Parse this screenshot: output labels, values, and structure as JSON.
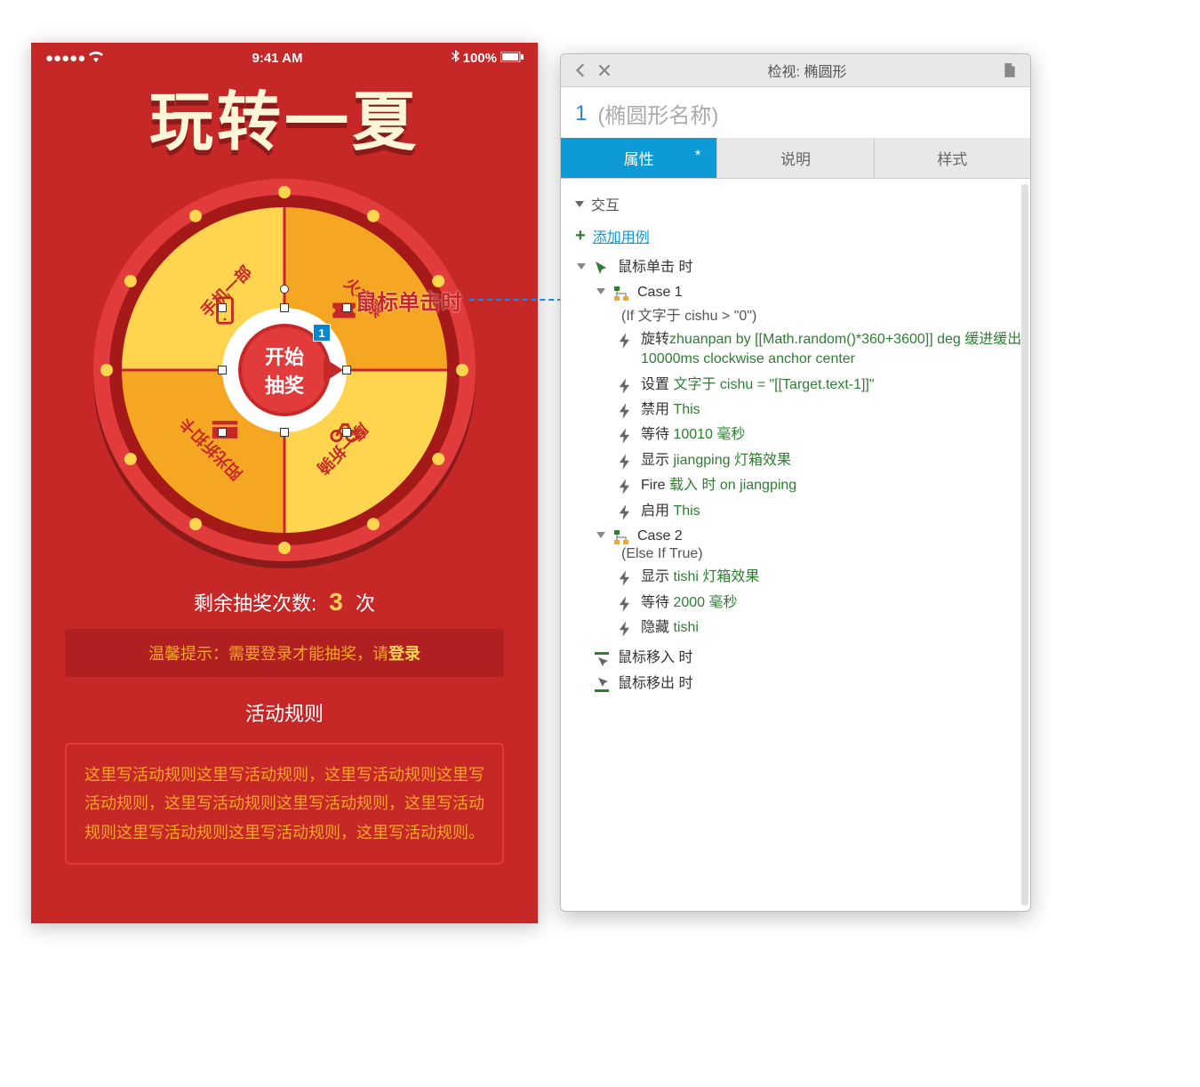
{
  "phone": {
    "status": {
      "time": "9:41 AM",
      "battery": "100%"
    },
    "title": "玩转一夏",
    "wheel": {
      "center_line1": "开始",
      "center_line2": "抽奖",
      "fn_badge": "1",
      "sectors": [
        "手机一部",
        "火车票",
        "阳光折扣卡",
        "摩一折骑"
      ]
    },
    "remaining": {
      "prefix": "剩余抽奖次数:",
      "count": "3",
      "suffix": "次"
    },
    "tip": {
      "text": "温馨提示：需要登录才能抽奖，请",
      "login": "登录"
    },
    "rules_title": "活动规则",
    "rules_body": "这里写活动规则这里写活动规则，这里写活动规则这里写活动规则，这里写活动规则这里写活动规则，这里写活动规则这里写活动规则这里写活动规则，这里写活动规则。"
  },
  "callout": "鼠标单击时",
  "panel": {
    "title": "检视: 椭圆形",
    "widget_index": "1",
    "widget_name": "(椭圆形名称)",
    "tabs": {
      "props": "属性",
      "notes": "说明",
      "style": "样式",
      "star": "*"
    },
    "section": "交互",
    "add_case": "添加用例",
    "events": {
      "click": "鼠标单击 时",
      "mouseenter": "鼠标移入 时",
      "mouseleave": "鼠标移出 时"
    },
    "case1": {
      "name": "Case 1",
      "condition": "(If 文字于 cishu > \"0\")",
      "a1_pre": "旋转",
      "a1_mid": "zhuanpan by [[Math.random()*360+3600]] deg 缓进缓出 10000ms clockwise anchor center",
      "a2_pre": "设置 ",
      "a2_mid": "文字于 cishu = \"[[Target.text-1]]\"",
      "a3_pre": "禁用 ",
      "a3_mid": "This",
      "a4_pre": "等待 ",
      "a4_mid": "10010 毫秒",
      "a5_pre": "显示 ",
      "a5_mid": "jiangping 灯箱效果",
      "a6_pre": "Fire ",
      "a6_mid": "载入 时 on jiangping",
      "a7_pre": "启用 ",
      "a7_mid": "This"
    },
    "case2": {
      "name": "Case 2",
      "condition": "(Else If True)",
      "a1_pre": "显示 ",
      "a1_mid": "tishi 灯箱效果",
      "a2_pre": "等待 ",
      "a2_mid": "2000 毫秒",
      "a3_pre": "隐藏 ",
      "a3_mid": "tishi"
    }
  }
}
